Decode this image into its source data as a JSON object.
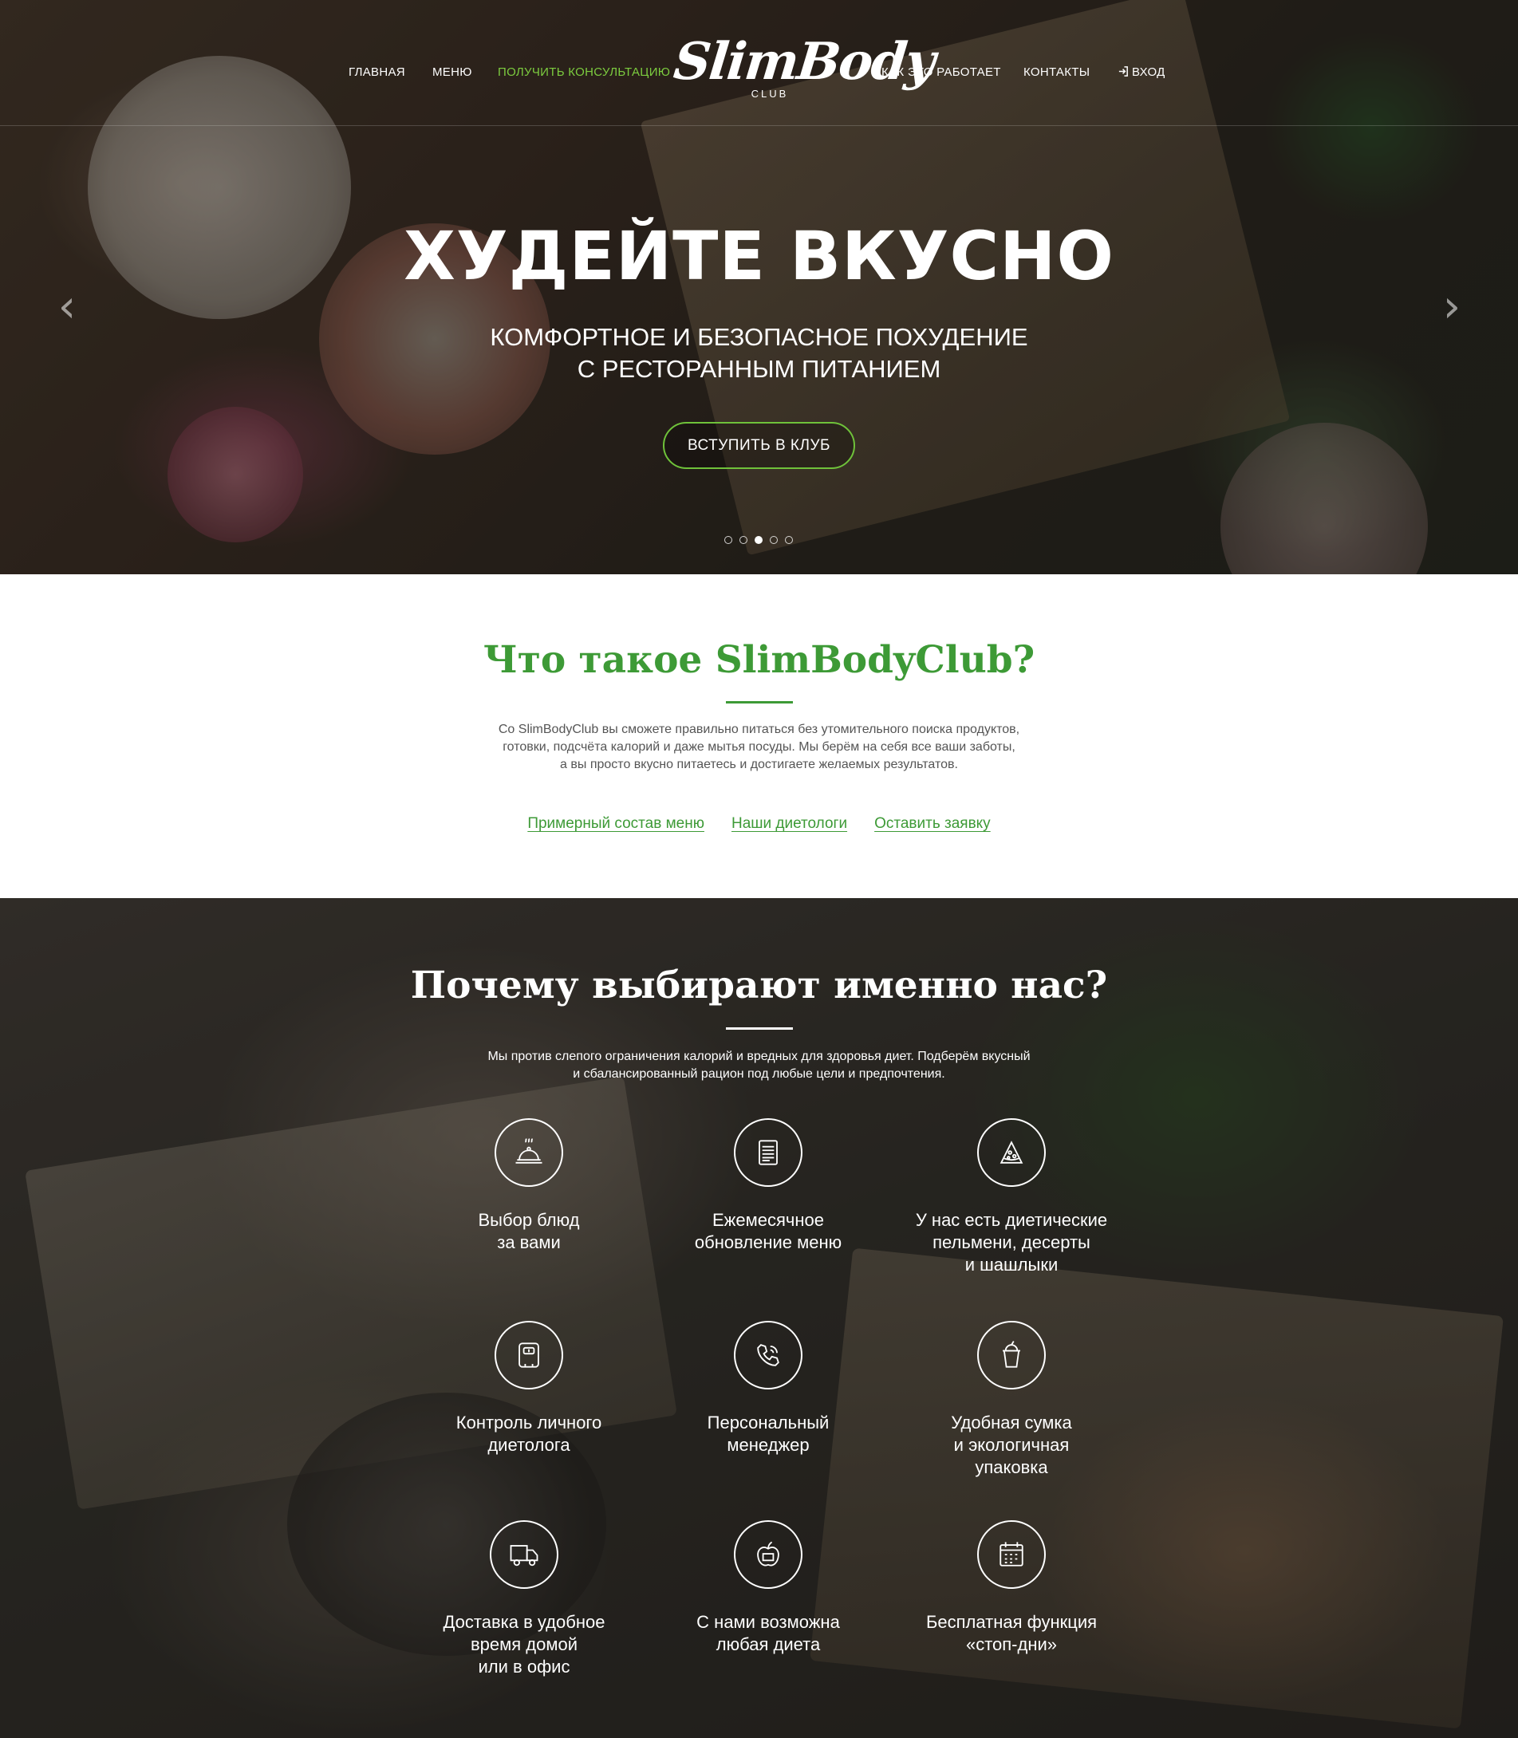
{
  "nav": {
    "items": [
      "ГЛАВНАЯ",
      "МЕНЮ",
      "ПОЛУЧИТЬ КОНСУЛЬТАЦИЮ",
      "КАК ЭТО РАБОТАЕТ",
      "КОНТАКТЫ"
    ],
    "login": "ВХОД",
    "accent_color": "#7ccc3f"
  },
  "logo": {
    "main": "SlimBody",
    "sub": "CLUB"
  },
  "hero": {
    "title": "ХУДЕЙТЕ ВКУСНО",
    "subtitle_line1": "КОМФОРТНОЕ И БЕЗОПАСНОЕ ПОХУДЕНИЕ",
    "subtitle_line2": "С РЕСТОРАННЫМ ПИТАНИЕМ",
    "cta": "ВСТУПИТЬ В КЛУБ",
    "slide_count": 5,
    "active_slide": 3
  },
  "about": {
    "title": "Что такое SlimBodyClub?",
    "text_line1": "Со SlimBodyClub вы сможете правильно питаться без утомительного поиска продуктов,",
    "text_line2": "готовки, подсчёта калорий и даже мытья посуды. Мы берём на себя все ваши заботы,",
    "text_line3": "а вы просто вкусно питаетесь и достигаете желаемых результатов.",
    "links": [
      "Примерный состав меню",
      "Наши диетологи",
      "Оставить заявку"
    ],
    "accent_color": "#3d9a36"
  },
  "why": {
    "title": "Почему выбирают именно нас?",
    "text_line1": "Мы против слепого ограничения калорий и вредных для здоровья диет. Подберём вкусный",
    "text_line2": "и сбалансированный рацион под любые цели и предпочтения.",
    "features": [
      {
        "icon": "cloche-icon",
        "label": "Выбор блюд\nза вами"
      },
      {
        "icon": "document-icon",
        "label": "Ежемесячное\nобновление меню"
      },
      {
        "icon": "pizza-slice-icon",
        "label": "У нас есть диетические\nпельмени, десерты\nи шашлыки"
      },
      {
        "icon": "scale-icon",
        "label": "Контроль личного\nдиетолога"
      },
      {
        "icon": "phone-icon",
        "label": "Персональный\nменеджер"
      },
      {
        "icon": "drink-cup-icon",
        "label": "Удобная сумка\nи экологичная\nупаковка"
      },
      {
        "icon": "delivery-truck-icon",
        "label": "Доставка в удобное\nвремя домой\nили в офис"
      },
      {
        "icon": "apple-icon",
        "label": "С нами возможна\nлюбая диета"
      },
      {
        "icon": "calendar-icon",
        "label": "Бесплатная функция\n«стоп-дни»"
      }
    ]
  }
}
